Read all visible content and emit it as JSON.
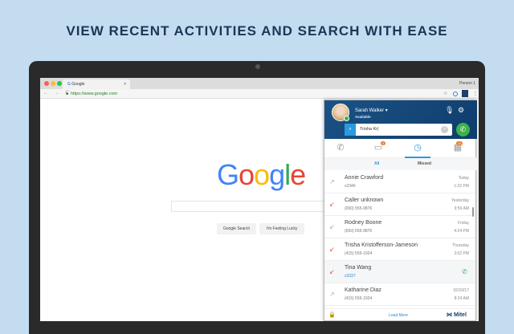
{
  "headline": "VIEW RECENT ACTIVITIES AND SEARCH WITH EASE",
  "browser": {
    "tab_title": "Google",
    "tab_close": "×",
    "person": "Person 1",
    "url": "https://www.google.com",
    "nav": "← → C"
  },
  "google": {
    "logo": [
      "G",
      "o",
      "o",
      "g",
      "l",
      "e"
    ],
    "logo_colors": [
      "#4285f4",
      "#ea4335",
      "#fbbc05",
      "#4285f4",
      "#34a853",
      "#ea4335"
    ],
    "search_button": "Google Search",
    "lucky_button": "I'm Feeling Lucky"
  },
  "popup": {
    "user": {
      "name": "Sarah Walker ▾",
      "status": "Available"
    },
    "search": {
      "value": "Trisha Kr|",
      "icon": "search-icon"
    },
    "tabs": {
      "chat_badge": "3",
      "calendar_badge": "12"
    },
    "subtabs": {
      "all": "All",
      "missed": "Missed"
    },
    "calls": [
      {
        "name": "Annie Crawford",
        "number": "x2346",
        "day": "Today",
        "time": "1:32 PM",
        "type": "outgoing"
      },
      {
        "name": "Caller unknown",
        "number": "(650) 555-9876",
        "day": "Yesterday",
        "time": "9:56 AM",
        "type": "missed"
      },
      {
        "name": "Rodney Boone",
        "number": "(650) 555-9876",
        "day": "Friday",
        "time": "4:24 PM",
        "type": "incoming"
      },
      {
        "name": "Trisha Kristofferson-Jameson",
        "number": "(415) 555-1924",
        "day": "Thursday",
        "time": "3:02 PM",
        "type": "missed"
      },
      {
        "name": "Tina Wang",
        "number": "x3337",
        "day": "",
        "time": "",
        "type": "missed"
      },
      {
        "name": "Katharine Diaz",
        "number": "(415) 555-1924",
        "day": "02/10/17",
        "time": "8:24 AM",
        "type": "outgoing"
      }
    ],
    "load_more": "Load More",
    "brand": "Mitel"
  },
  "colors": {
    "accent": "#2a9ae0",
    "missed": "#e8534a",
    "green": "#3cb34a"
  }
}
